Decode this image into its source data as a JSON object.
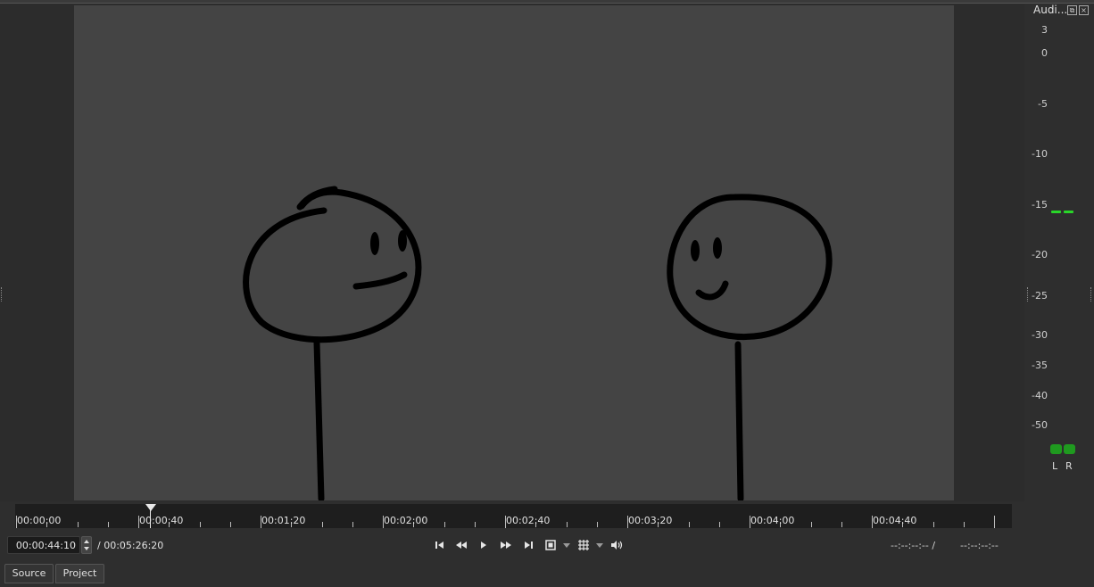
{
  "audio_meter": {
    "title": "Audi...",
    "float_icon": "float-icon",
    "close_icon": "close-icon",
    "scale_labels": [
      "3",
      "0",
      "-5",
      "-10",
      "-15",
      "-20",
      "-25",
      "-30",
      "-35",
      "-40",
      "-50"
    ],
    "channels": [
      "L",
      "R"
    ],
    "level_color": "#1f9a1f",
    "peak_color": "#29d629"
  },
  "timeline_ruler": {
    "labels": [
      "00:00:00",
      "00:00:40",
      "00:01:20",
      "00:02:00",
      "00:02:40",
      "00:03:20",
      "00:04:00",
      "00:04:40"
    ],
    "playhead_icon": "playhead-marker-icon"
  },
  "transport": {
    "position": "00:00:44:10",
    "duration": "/ 00:05:26:20",
    "in_point": "--:--:--:-- /",
    "out_point": "--:--:--:--",
    "icons": [
      "skip-to-start-icon",
      "rewind-icon",
      "play-icon",
      "fast-forward-icon",
      "skip-to-end-icon",
      "zoom-icon",
      "grid-icon",
      "volume-icon"
    ]
  },
  "tabs": [
    "Source",
    "Project"
  ]
}
